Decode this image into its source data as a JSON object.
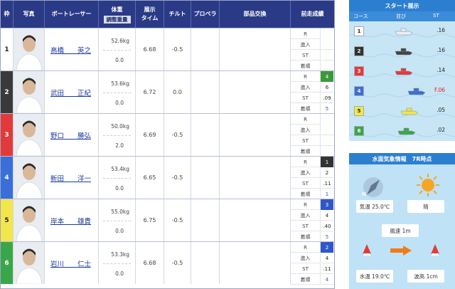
{
  "table": {
    "headers": {
      "waku": "枠",
      "photo": "写真",
      "racer": "ボートレーサー",
      "weight": "体重",
      "weight_adj": "調整重量",
      "exhibit_l1": "展示",
      "exhibit_l2": "タイム",
      "tilt": "チルト",
      "propeller": "プロペラ",
      "parts": "部品交換",
      "prev": "前走成績"
    },
    "prev_labels": [
      "R",
      "進入",
      "ST",
      "着順"
    ],
    "rows": [
      {
        "waku": "1",
        "name": "高橋　　英之",
        "weight": "52.6kg",
        "adj": "0.0",
        "time": "6.68",
        "tilt": "-0.5",
        "prev": [
          "",
          "",
          "",
          ""
        ],
        "waku_bg": "#ffffff",
        "waku_fg": "#222222",
        "r_bg": "#ffffff",
        "r_fg": "#222222"
      },
      {
        "waku": "2",
        "name": "武田　　正紀",
        "weight": "53.6kg",
        "adj": "0.0",
        "time": "6.72",
        "tilt": "0.0",
        "prev": [
          "4",
          "6",
          ".09",
          "5"
        ],
        "waku_bg": "#3a3a3a",
        "waku_fg": "#ffffff",
        "r_bg": "#3a9a3a",
        "r_fg": "#ffffff"
      },
      {
        "waku": "3",
        "name": "野口　　勝弘",
        "weight": "50.0kg",
        "adj": "2.0",
        "time": "6.69",
        "tilt": "-0.5",
        "prev": [
          "",
          "",
          "",
          ""
        ],
        "waku_bg": "#e23a3a",
        "waku_fg": "#ffffff",
        "r_bg": "#ffffff",
        "r_fg": "#222222"
      },
      {
        "waku": "4",
        "name": "新田　　洋一",
        "weight": "53.4kg",
        "adj": "0.0",
        "time": "6.65",
        "tilt": "-0.5",
        "prev": [
          "1",
          "2",
          ".11",
          "1"
        ],
        "waku_bg": "#3a6ed8",
        "waku_fg": "#ffffff",
        "r_bg": "#333333",
        "r_fg": "#ffffff"
      },
      {
        "waku": "5",
        "name": "岸本　　雄貴",
        "weight": "55.0kg",
        "adj": "0.0",
        "time": "6.75",
        "tilt": "-0.5",
        "prev": [
          "3",
          "4",
          ".40",
          "5"
        ],
        "waku_bg": "#f2e64a",
        "waku_fg": "#222222",
        "r_bg": "#2f57c8",
        "r_fg": "#ffffff"
      },
      {
        "waku": "6",
        "name": "岩川　　仁士",
        "weight": "53.3kg",
        "adj": "0.0",
        "time": "6.68",
        "tilt": "-0.5",
        "prev": [
          "2",
          "4",
          ".11",
          "4"
        ],
        "waku_bg": "#3aa64a",
        "waku_fg": "#ffffff",
        "r_bg": "#2f57c8",
        "r_fg": "#ffffff"
      }
    ]
  },
  "start": {
    "title": "スタート展示",
    "head_course": "コース",
    "head_order": "並び",
    "head_st": "ST",
    "rows": [
      {
        "course": "1",
        "st": ".16",
        "bg": "#ffffff",
        "fg": "#222222",
        "boat": "#e8eef4",
        "offset": 0,
        "st_color": "#222222"
      },
      {
        "course": "2",
        "st": ".16",
        "bg": "#333333",
        "fg": "#ffffff",
        "boat": "#444444",
        "offset": 0,
        "st_color": "#222222"
      },
      {
        "course": "3",
        "st": ".14",
        "bg": "#e23a3a",
        "fg": "#ffffff",
        "boat": "#e23a3a",
        "offset": 0,
        "st_color": "#222222"
      },
      {
        "course": "4",
        "st": "F.06",
        "bg": "#3a6ed8",
        "fg": "#ffffff",
        "boat": "#3a6ed8",
        "offset": 18,
        "st_color": "#e02020"
      },
      {
        "course": "5",
        "st": ".05",
        "bg": "#f2e64a",
        "fg": "#222222",
        "boat": "#f2e64a",
        "offset": 8,
        "st_color": "#222222"
      },
      {
        "course": "6",
        "st": ".02",
        "bg": "#3aa64a",
        "fg": "#ffffff",
        "boat": "#3aa64a",
        "offset": 4,
        "st_color": "#222222"
      }
    ]
  },
  "weather": {
    "title": "水面気象情報　7R時点",
    "temp": "気温 25.0℃",
    "sky": "晴",
    "wind": "風速 1m",
    "water_temp": "水温 19.0℃",
    "wave": "波高 1cm",
    "compass_n": "N"
  },
  "colors": {
    "header_bg": "#2a3a86",
    "panel_title": "#2c7fd0",
    "link": "#1a3aa0"
  }
}
